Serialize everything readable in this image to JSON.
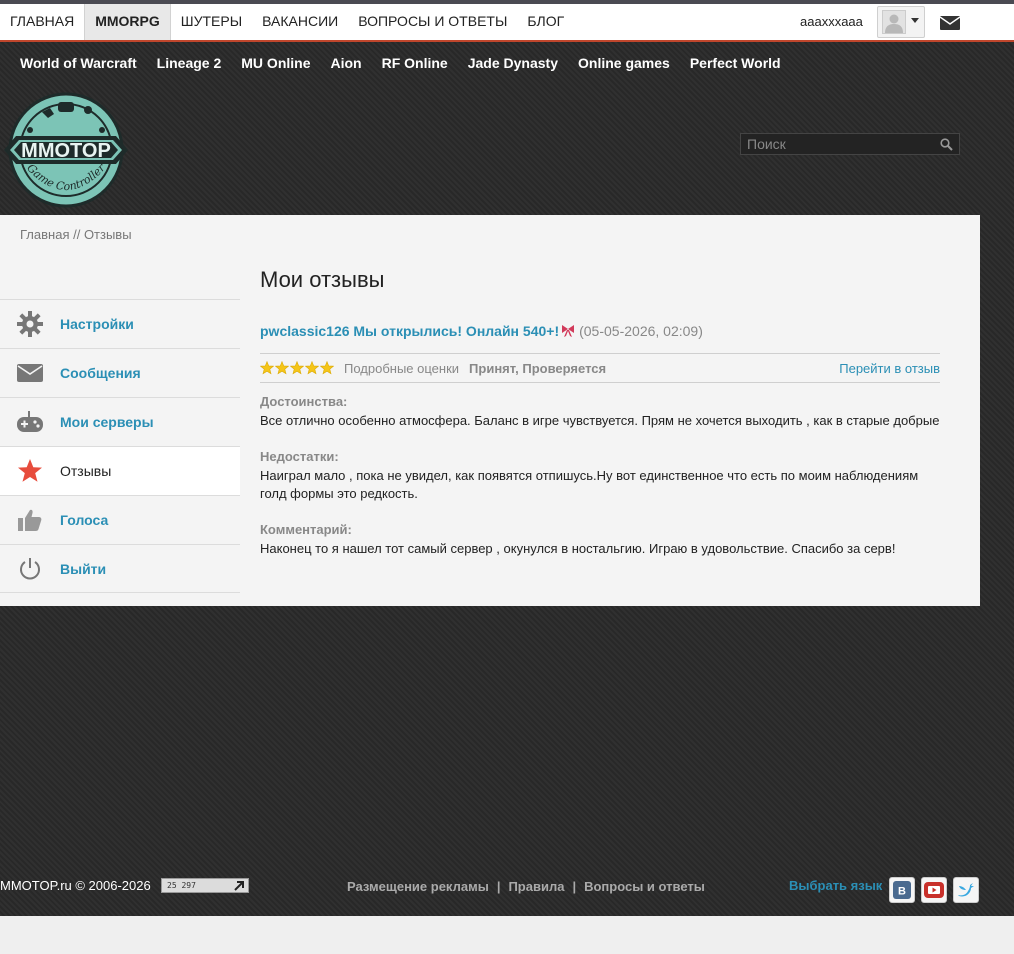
{
  "topnav": {
    "items": [
      "ГЛАВНАЯ",
      "MMORPG",
      "ШУТЕРЫ",
      "ВАКАНСИИ",
      "ВОПРОСЫ И ОТВЕТЫ",
      "БЛОГ"
    ],
    "active_index": 1
  },
  "user": {
    "name": "aaaxxxaaa"
  },
  "gamenav": {
    "items": [
      "World of Warcraft",
      "Lineage 2",
      "MU Online",
      "Aion",
      "RF Online",
      "Jade Dynasty",
      "Online games",
      "Perfect World"
    ]
  },
  "logo": {
    "text": "MMOTOP",
    "subtext": "Game Controller"
  },
  "search": {
    "placeholder": "Поиск"
  },
  "breadcrumb": {
    "home": "Главная",
    "sep": " // ",
    "current": "Отзывы"
  },
  "sidebar": {
    "items": [
      {
        "label": "Настройки",
        "icon": "gear-icon"
      },
      {
        "label": "Сообщения",
        "icon": "envelope-icon"
      },
      {
        "label": "Мои серверы",
        "icon": "gamepad-icon"
      },
      {
        "label": "Отзывы",
        "icon": "star-icon"
      },
      {
        "label": "Голоса",
        "icon": "thumbs-up-icon"
      },
      {
        "label": "Выйти",
        "icon": "power-icon"
      }
    ],
    "active_index": 3
  },
  "main": {
    "title": "Мои отзывы",
    "review": {
      "title": "pwclassic126 Мы открылись! Онлайн 540+!",
      "badge_icon": "ribbon-icon",
      "date": "(05-05-2026, 02:09)",
      "rating": 5,
      "rating_max": 5,
      "details_label": "Подробные оценки",
      "status": "Принят, Проверяется",
      "goto_label": "Перейти в отзыв",
      "pros_title": "Достоинства:",
      "pros_text": "Все отлично особенно атмосфера. Баланс в игре чувствуется. Прям не хочется выходить , как в старые добрые",
      "cons_title": "Недостатки:",
      "cons_text": "Наиграл мало , пока не увидел, как появятся отпишусь.Ну вот единственное что есть по моим наблюдениям голд формы это редкость.",
      "comment_title": "Комментарий:",
      "comment_text": "Наконец то я нашел тот самый сервер , окунулся в ностальгию. Играю в удовольствие. Спасибо за серв!"
    }
  },
  "footer": {
    "copyright": "MMOTOP.ru © 2006-2026",
    "counter": "25 297",
    "links": [
      "Размещение рекламы",
      "Правила",
      "Вопросы и ответы"
    ],
    "language": "Выбрать язык",
    "social": [
      "vk-icon",
      "youtube-icon",
      "twitter-icon"
    ]
  },
  "colors": {
    "accent": "#2b8fb5",
    "topbar_border": "#c0462c",
    "star": "#f5c518",
    "active_star": "#e74c3c"
  }
}
